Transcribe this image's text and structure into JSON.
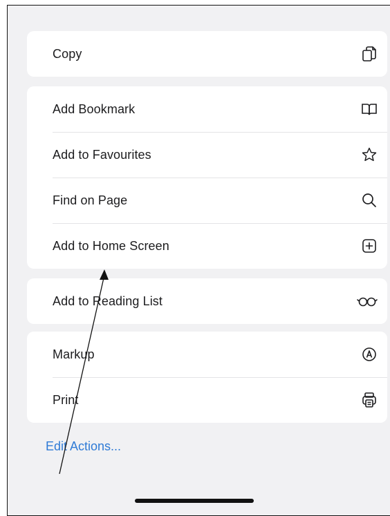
{
  "groups": [
    {
      "items": [
        {
          "label": "Copy",
          "icon": "copy-icon"
        }
      ]
    },
    {
      "items": [
        {
          "label": "Add Bookmark",
          "icon": "book-icon"
        },
        {
          "label": "Add to Favourites",
          "icon": "star-icon"
        },
        {
          "label": "Find on Page",
          "icon": "search-icon"
        },
        {
          "label": "Add to Home Screen",
          "icon": "plus-square-icon"
        }
      ]
    },
    {
      "items": [
        {
          "label": "Add to Reading List",
          "icon": "glasses-icon"
        }
      ]
    },
    {
      "items": [
        {
          "label": "Markup",
          "icon": "markup-icon"
        },
        {
          "label": "Print",
          "icon": "printer-icon"
        }
      ]
    }
  ],
  "edit_actions": {
    "label": "Edit Actions..."
  },
  "colors": {
    "link": "#2f7bd6",
    "background": "#f1f1f3",
    "card": "#ffffff"
  }
}
